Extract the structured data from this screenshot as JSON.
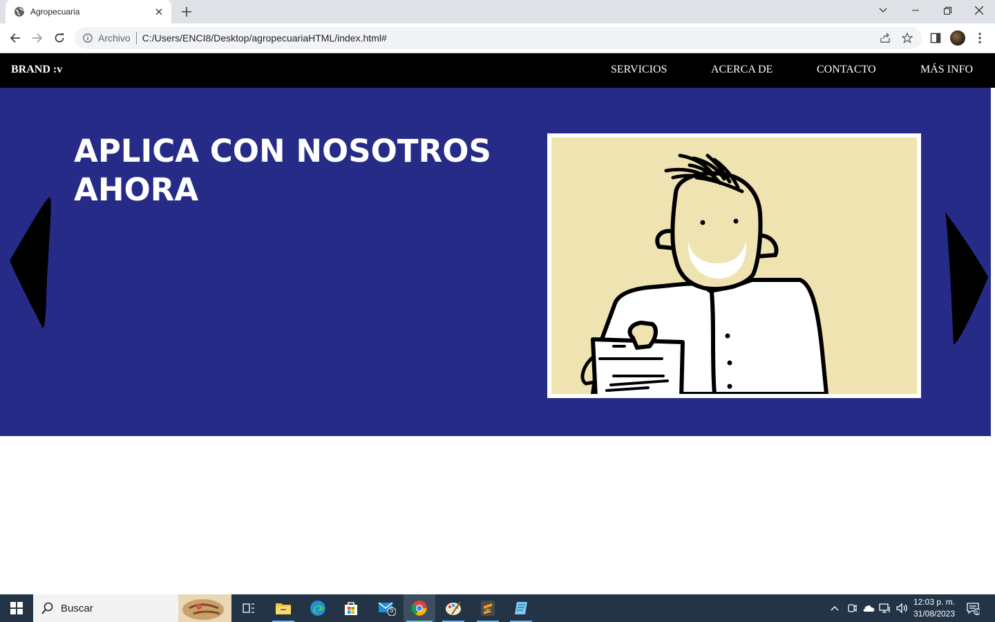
{
  "browser": {
    "tab_title": "Agropecuaria",
    "scheme_label": "Archivo",
    "url": "C:/Users/ENCI8/Desktop/agropecuariaHTML/index.html#"
  },
  "site": {
    "brand": "BRAND :v",
    "nav": [
      "SERVICIOS",
      "ACERCA DE",
      "CONTACTO",
      "MÁS INFO"
    ],
    "hero_title": "APLICA CON NOSOTROS AHORA",
    "colors": {
      "nav_bg": "#000000",
      "hero_bg": "#262b87",
      "image_bg": "#efe3b1"
    }
  },
  "taskbar": {
    "search_placeholder": "Buscar",
    "mail_badge": "5",
    "time": "12:03 p. m.",
    "date": "31/08/2023",
    "notification_count": "5"
  }
}
